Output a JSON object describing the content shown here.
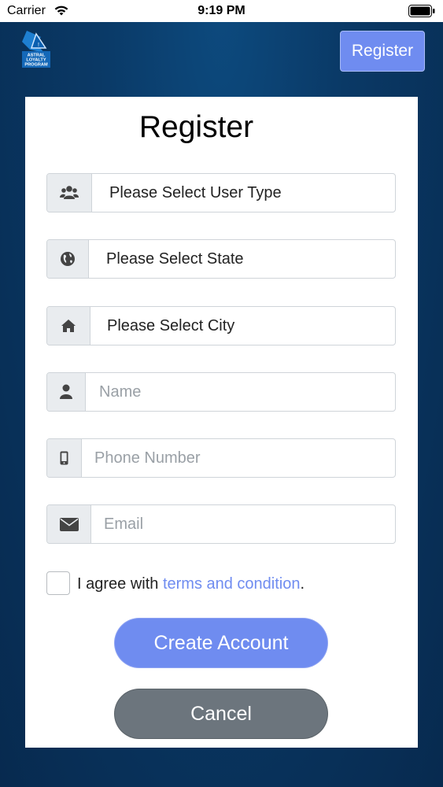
{
  "status_bar": {
    "carrier": "Carrier",
    "time": "9:19 PM"
  },
  "header": {
    "logo_text_lines": [
      "ASTRAL",
      "LOYALTY",
      "PROGRAM"
    ],
    "register_button": "Register"
  },
  "form": {
    "title": "Register",
    "user_type": {
      "value": "Please Select User Type",
      "icon": "users-icon"
    },
    "state": {
      "value": "Please Select State",
      "icon": "globe-icon"
    },
    "city": {
      "value": "Please Select City",
      "icon": "home-icon"
    },
    "name": {
      "placeholder": "Name",
      "icon": "user-icon"
    },
    "phone": {
      "placeholder": "Phone Number",
      "icon": "mobile-icon"
    },
    "email": {
      "placeholder": "Email",
      "icon": "envelope-icon"
    },
    "agree_prefix": "I agree with ",
    "agree_link": "terms and condition",
    "agree_suffix": ".",
    "create_button": "Create Account",
    "cancel_button": "Cancel"
  },
  "colors": {
    "accent": "#6f8cf0",
    "cancel": "#6c757d",
    "background": "#0a3966"
  }
}
